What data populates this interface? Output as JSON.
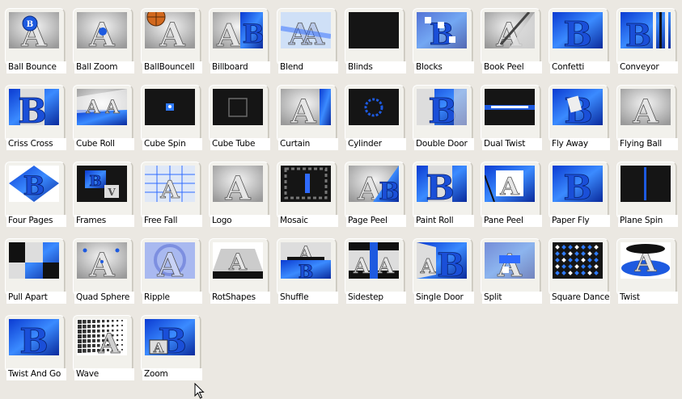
{
  "effects": [
    {
      "label": "Ball Bounce",
      "icon": "ball-bounce-icon",
      "style": "ball"
    },
    {
      "label": "Ball Zoom",
      "icon": "ball-zoom-icon",
      "style": "ballzoom"
    },
    {
      "label": "BallBounceII",
      "icon": "ball-bounce-ii-icon",
      "style": "basketball"
    },
    {
      "label": "Billboard",
      "icon": "billboard-icon",
      "style": "billboard"
    },
    {
      "label": "Blend",
      "icon": "blend-icon",
      "style": "blend"
    },
    {
      "label": "Blinds",
      "icon": "blinds-icon",
      "style": "dark"
    },
    {
      "label": "Blocks",
      "icon": "blocks-icon",
      "style": "blocks"
    },
    {
      "label": "Book Peel",
      "icon": "book-peel-icon",
      "style": "peel"
    },
    {
      "label": "Confetti",
      "icon": "confetti-icon",
      "style": "blueB"
    },
    {
      "label": "Conveyor",
      "icon": "conveyor-icon",
      "style": "conveyor"
    },
    {
      "label": "Criss Cross",
      "icon": "criss-cross-icon",
      "style": "crisscross"
    },
    {
      "label": "Cube Roll",
      "icon": "cube-roll-icon",
      "style": "cuberoll"
    },
    {
      "label": "Cube Spin",
      "icon": "cube-spin-icon",
      "style": "cubespin"
    },
    {
      "label": "Cube Tube",
      "icon": "cube-tube-icon",
      "style": "cubetube"
    },
    {
      "label": "Curtain",
      "icon": "curtain-icon",
      "style": "curtain"
    },
    {
      "label": "Cylinder",
      "icon": "cylinder-icon",
      "style": "cylinder"
    },
    {
      "label": "Double Door",
      "icon": "double-door-icon",
      "style": "doubledoor"
    },
    {
      "label": "Dual Twist",
      "icon": "dual-twist-icon",
      "style": "dualtwist"
    },
    {
      "label": "Fly Away",
      "icon": "fly-away-icon",
      "style": "flyaway"
    },
    {
      "label": "Flying Ball",
      "icon": "flying-ball-icon",
      "style": "grayA"
    },
    {
      "label": "Four Pages",
      "icon": "four-pages-icon",
      "style": "fourpages"
    },
    {
      "label": "Frames",
      "icon": "frames-icon",
      "style": "frames"
    },
    {
      "label": "Free Fall",
      "icon": "free-fall-icon",
      "style": "freefall"
    },
    {
      "label": "Logo",
      "icon": "logo-icon",
      "style": "grayA"
    },
    {
      "label": "Mosaic",
      "icon": "mosaic-icon",
      "style": "mosaic"
    },
    {
      "label": "Page Peel",
      "icon": "page-peel-icon",
      "style": "pagepeel"
    },
    {
      "label": "Paint Roll",
      "icon": "paint-roll-icon",
      "style": "crisscross"
    },
    {
      "label": "Pane Peel",
      "icon": "pane-peel-icon",
      "style": "panepeel"
    },
    {
      "label": "Paper Fly",
      "icon": "paper-fly-icon",
      "style": "blueB"
    },
    {
      "label": "Plane Spin",
      "icon": "plane-spin-icon",
      "style": "planespin"
    },
    {
      "label": "Pull Apart",
      "icon": "pull-apart-icon",
      "style": "pullapart"
    },
    {
      "label": "Quad Sphere",
      "icon": "quad-sphere-icon",
      "style": "quadsphere"
    },
    {
      "label": "Ripple",
      "icon": "ripple-icon",
      "style": "ripple"
    },
    {
      "label": "RotShapes",
      "icon": "rot-shapes-icon",
      "style": "rotshapes"
    },
    {
      "label": "Shuffle",
      "icon": "shuffle-icon",
      "style": "shuffle"
    },
    {
      "label": "Sidestep",
      "icon": "sidestep-icon",
      "style": "sidestep"
    },
    {
      "label": "Single Door",
      "icon": "single-door-icon",
      "style": "singledoor"
    },
    {
      "label": "Split",
      "icon": "split-icon",
      "style": "split"
    },
    {
      "label": "Square Dance",
      "icon": "square-dance-icon",
      "style": "squaredance"
    },
    {
      "label": "Twist",
      "icon": "twist-icon",
      "style": "twist"
    },
    {
      "label": "Twist And Go",
      "icon": "twist-and-go-icon",
      "style": "blueB"
    },
    {
      "label": "Wave",
      "icon": "wave-icon",
      "style": "wave"
    },
    {
      "label": "Zoom",
      "icon": "zoom-icon",
      "style": "zoom"
    }
  ],
  "colors": {
    "background": "#ebe8e2",
    "blue": "#1a4fd8",
    "brightBlue": "#2f7bff",
    "gray": "#bdbdbd",
    "dark": "#151515"
  },
  "cursor": {
    "icon": "mouse-pointer-icon"
  }
}
